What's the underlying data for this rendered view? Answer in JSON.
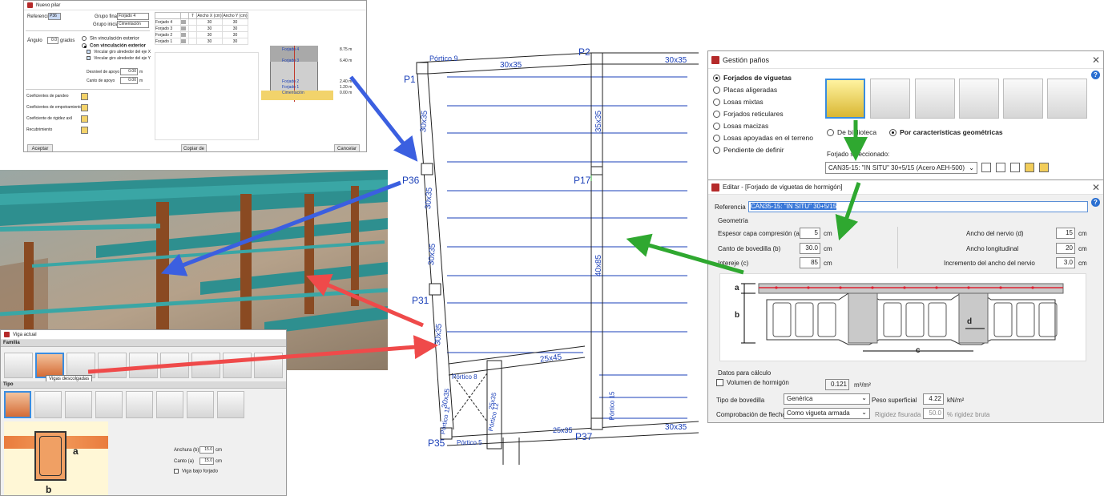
{
  "nuevo_pilar": {
    "title": "Nuevo pilar",
    "referencia_label": "Referencia",
    "referencia_value": "P36",
    "grupo_final_label": "Grupo final",
    "grupo_final_value": "Forjado 4",
    "grupo_inicial_label": "Grupo inicial",
    "grupo_inicial_value": "Cimentación",
    "angulo_label": "Ángulo",
    "angulo_value": "0.0",
    "angulo_unit": "grados",
    "options": [
      "Sin vinculación exterior",
      "Con vinculación exterior"
    ],
    "checks": [
      "Vincular giro alrededor del eje X",
      "Vincular giro alrededor del eje Y"
    ],
    "desnivel_label": "Desnivel de apoyo",
    "desnivel_value": "0.00",
    "desnivel_unit": "m",
    "canto_label": "Canto de apoyo",
    "canto_value": "0.00",
    "canto_unit": "m",
    "coeficientes": [
      "Coeficientes de pandeo",
      "Coeficientes de empotramiento",
      "Coeficiente de rigidez axil",
      "Recubrimiento"
    ],
    "table_headers": [
      "",
      "T",
      "Ancho X (cm)",
      "Ancho Y (cm)"
    ],
    "table_rows": [
      {
        "name": "Forjado 4",
        "x": "30",
        "y": "30"
      },
      {
        "name": "Forjado 3",
        "x": "30",
        "y": "30"
      },
      {
        "name": "Forjado 2",
        "x": "30",
        "y": "30"
      },
      {
        "name": "Forjado 1",
        "x": "30",
        "y": "30"
      }
    ],
    "section_labels": [
      "Forjado 4",
      "Forjado 3",
      "Forjado 2",
      "Forjado 1",
      "Cimentación"
    ],
    "section_levels": [
      "8.75 m",
      "6.40 m",
      "2.40 m",
      "1.20 m",
      "0.00 m"
    ],
    "aceptar": "Aceptar",
    "copiar": "Copiar de",
    "cancelar": "Cancelar"
  },
  "plan": {
    "pillars": [
      "P1",
      "P2",
      "P36",
      "P17",
      "P31",
      "P35",
      "P37"
    ],
    "beam_labels": {
      "top_left": "Pórtico 9",
      "top_mid": "30x35",
      "top_right": "30x35",
      "left_col1": "30x35",
      "left_col2": "30x35",
      "left_col3": "30x35",
      "left_col4": "30x35",
      "mid_col": "35x35",
      "mid_col2": "40x85",
      "diag": "25x45",
      "portico8": "Pórtico 8",
      "bottom_left": "30x35",
      "bottom_portico11": "Pórtico 11",
      "bottom_portico12": "Pórtico 12",
      "bottom_portico15": "Pórtico 15",
      "bottom_mid": "25x35",
      "bottom_right": "30x35",
      "bottom_portico5": "Pórtico 5",
      "bottom_12": "25x35"
    }
  },
  "gestion": {
    "title": "Gestión paños",
    "options": [
      "Forjados de viguetas",
      "Placas aligeradas",
      "Losas mixtas",
      "Forjados reticulares",
      "Losas macizas",
      "Losas apoyadas en el terreno",
      "Pendiente de definir"
    ],
    "radio_a": "De biblioteca",
    "radio_b": "Por características geométricas",
    "forjado_label": "Forjado seleccionado:",
    "forjado_value": "CAN35-15:  \"IN SITU\" 30+5/15  (Acero AEH-500)"
  },
  "editar": {
    "title": "Editar - [Forjado de viguetas de hormigón]",
    "referencia_label": "Referencia",
    "referencia_value": "CAN35-15:  \"IN SITU\" 30+5/15",
    "geometria": "Geometría",
    "espesor_label": "Espesor capa compresión (a)",
    "espesor_value": "5",
    "canto_label": "Canto de bovedilla (b)",
    "canto_value": "30.0",
    "intereje_label": "Intereje (c)",
    "intereje_value": "85",
    "ancho_nervio_label": "Ancho del nervio (d)",
    "ancho_nervio_value": "15",
    "ancho_long_label": "Ancho longitudinal",
    "ancho_long_value": "20",
    "incremento_label": "Incremento del ancho del nervio",
    "incremento_value": "3.0",
    "unit_cm": "cm",
    "datos": "Datos para cálculo",
    "volumen_label": "Volumen de hormigón",
    "volumen_value": "0.121",
    "volumen_unit": "m³/m²",
    "tipo_label": "Tipo de bovedilla",
    "tipo_value": "Genérica",
    "peso_label": "Peso superficial",
    "peso_value": "4.22",
    "peso_unit": "kN/m²",
    "comp_label": "Comprobación de flecha",
    "comp_value": "Como vigueta armada",
    "rigidez_label": "Rigidez fisurada",
    "rigidez_value": "50.0",
    "rigidez_unit": "% rigidez bruta",
    "dim_a": "a",
    "dim_b": "b",
    "dim_c": "c",
    "dim_d": "d"
  },
  "viga": {
    "title": "Viga actual",
    "familia": "Familia",
    "tooltip": "Vigas descolgadas",
    "tipo": "Tipo",
    "anchura_label": "Anchura (b)",
    "anchura_value": "15.0",
    "canto_label": "Canto (a)",
    "canto_value": "15.0",
    "unit": "cm",
    "bajo_forjado": "Viga bajo forjado",
    "dim_a": "a",
    "dim_b": "b"
  },
  "colors": {
    "blue_arrow": "#3b5fe0",
    "red_arrow": "#ef4a4a",
    "green_arrow": "#2fa830",
    "plan_blue": "#1a3fb8"
  }
}
